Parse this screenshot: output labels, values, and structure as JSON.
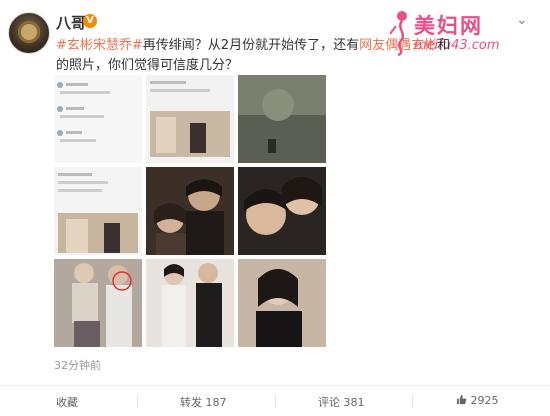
{
  "post": {
    "username": "八哥",
    "vip_badge": "V",
    "text_hashtag1": "#玄彬宋慧乔#",
    "text_plain1": "再传绯闻？从2月份就开始传了，还有",
    "text_link1": "网友偶遇玄彬",
    "text_plain2": "和",
    "text_plain3": "的照片，你们觉得可信度几分？",
    "timestamp": "32分钟前"
  },
  "watermark": {
    "cn": "美妇网",
    "url": "meifu43.com"
  },
  "actions": {
    "favorite": "收藏",
    "repost": "转发 187",
    "comment": "评论 381",
    "like": "2925"
  },
  "icons": [
    "chevron-down-icon",
    "thumb-up-icon",
    "vip-icon"
  ],
  "colors": {
    "accent": "#eb7350",
    "watermark": "#e8508a"
  }
}
